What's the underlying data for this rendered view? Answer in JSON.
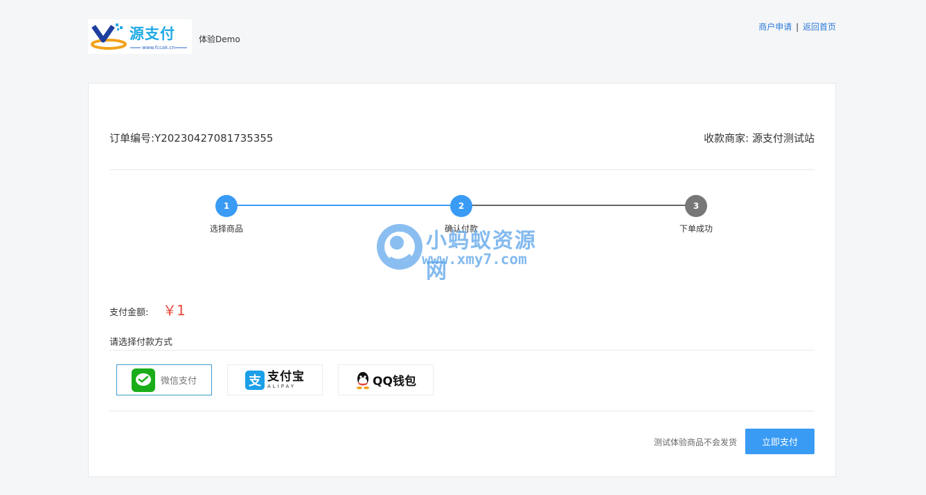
{
  "header": {
    "logo_text": "源支付",
    "logo_url": "www.fccak.cn",
    "demo_text": "体验Demo",
    "links": [
      {
        "label": "商户申请"
      },
      {
        "label": "返回首页"
      }
    ],
    "separator": "|"
  },
  "order": {
    "number_label": "订单编号:Y20230427081735355",
    "merchant_label": "收款商家: 源支付测试站"
  },
  "steps": [
    {
      "number": "1",
      "label": "选择商品",
      "status": "done",
      "color": "#3a9bf5"
    },
    {
      "number": "2",
      "label": "确认付款",
      "status": "active",
      "color": "#3a9bf5"
    },
    {
      "number": "3",
      "label": "下单成功",
      "status": "pending",
      "color": "#777777"
    }
  ],
  "watermark": {
    "title": "小蚂蚁资源网",
    "url": "www.xmy7.com"
  },
  "payment": {
    "amount_label": "支付金额:",
    "amount": "￥1",
    "choose_label": "请选择付款方式",
    "methods": [
      {
        "name": "微信支付",
        "icon": "wechat-pay-icon",
        "selected": true
      },
      {
        "name": "支付宝",
        "sub": "ALIPAY",
        "icon": "alipay-icon",
        "selected": false
      },
      {
        "name": "QQ钱包",
        "icon": "qq-wallet-icon",
        "selected": false
      }
    ],
    "notice": "测试体验商品不会发货",
    "submit_label": "立即支付"
  },
  "colors": {
    "accent": "#3a9bf5",
    "price": "#e8473a",
    "link": "#2b7bd6"
  }
}
